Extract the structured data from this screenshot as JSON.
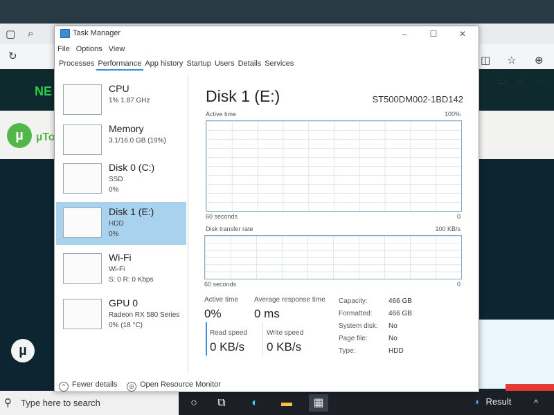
{
  "window": {
    "title": "Task Manager"
  },
  "menu": [
    "File",
    "Options",
    "View"
  ],
  "tabs": [
    {
      "label": "Processes",
      "active": false
    },
    {
      "label": "Performance",
      "active": true
    },
    {
      "label": "App history",
      "active": false
    },
    {
      "label": "Startup",
      "active": false
    },
    {
      "label": "Users",
      "active": false
    },
    {
      "label": "Details",
      "active": false
    },
    {
      "label": "Services",
      "active": false
    }
  ],
  "resources": [
    {
      "name": "CPU",
      "sub1": "1%  1.87 GHz",
      "sub2": ""
    },
    {
      "name": "Memory",
      "sub1": "3.1/16.0 GB (19%)",
      "sub2": ""
    },
    {
      "name": "Disk 0 (C:)",
      "sub1": "SSD",
      "sub2": "0%"
    },
    {
      "name": "Disk 1 (E:)",
      "sub1": "HDD",
      "sub2": "0%",
      "selected": true
    },
    {
      "name": "Wi-Fi",
      "sub1": "Wi-Fi",
      "sub2": "S: 0  R: 0 Kbps"
    },
    {
      "name": "GPU 0",
      "sub1": "Radeon RX 580 Series",
      "sub2": "0%  (18 °C)"
    }
  ],
  "detail": {
    "title": "Disk 1 (E:)",
    "model": "ST500DM002-1BD142",
    "active_time_label": "Active time",
    "active_time_max": "100%",
    "graph1_left": "60 seconds",
    "graph1_right": "0",
    "transfer_label": "Disk transfer rate",
    "transfer_max": "100 KB/s",
    "graph2_left": "60 seconds",
    "graph2_right": "0",
    "active_time_stat_label": "Active time",
    "active_time_stat": "0%",
    "avg_resp_label": "Average response time",
    "avg_resp": "0 ms",
    "read_label": "Read speed",
    "read": "0 KB/s",
    "write_label": "Write speed",
    "write": "0 KB/s",
    "props": [
      {
        "label": "Capacity:",
        "value": "466 GB"
      },
      {
        "label": "Formatted:",
        "value": "466 GB"
      },
      {
        "label": "System disk:",
        "value": "No"
      },
      {
        "label": "Page file:",
        "value": "No"
      },
      {
        "label": "Type:",
        "value": "HDD"
      }
    ]
  },
  "footer": {
    "fewer": "Fewer details",
    "monitor": "Open Resource Monitor"
  },
  "taskbar": {
    "search_placeholder": "Type here to search",
    "weather": "Result"
  },
  "background": {
    "site_label": "NE",
    "logo_text": "µTo"
  }
}
